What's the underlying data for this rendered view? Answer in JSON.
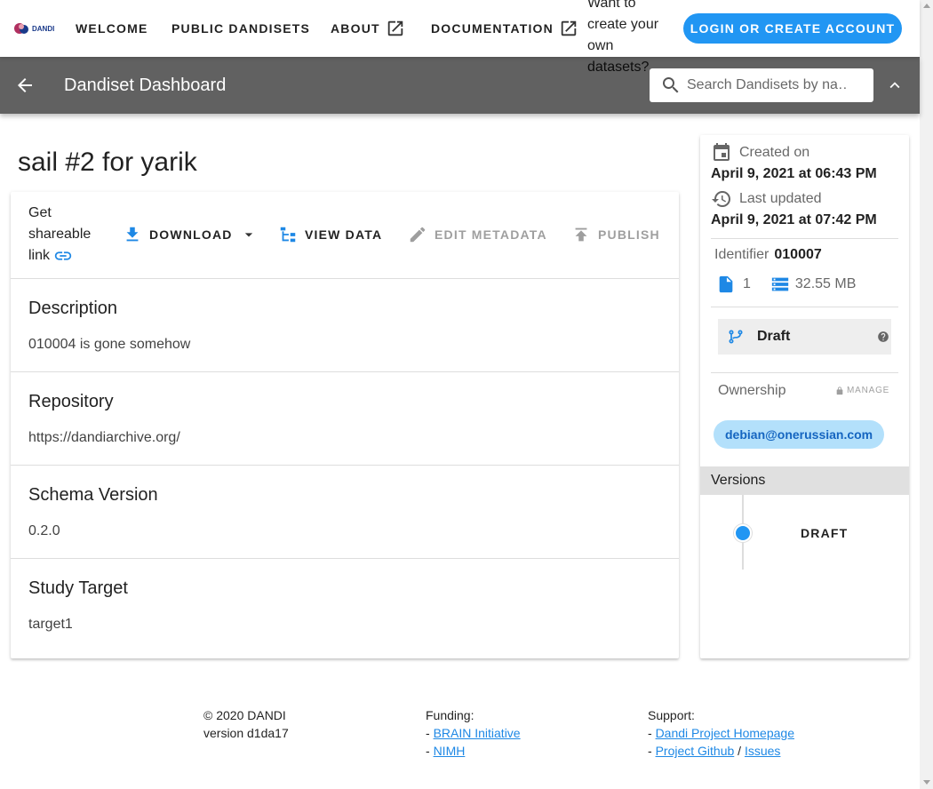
{
  "nav": {
    "logo_text": "DANDI",
    "links": [
      {
        "label": "WELCOME"
      },
      {
        "label": "PUBLIC DANDISETS"
      },
      {
        "label": "ABOUT"
      },
      {
        "label": "DOCUMENTATION"
      }
    ],
    "promo": "Want to create your own datasets?",
    "login_label": "LOGIN OR CREATE ACCOUNT"
  },
  "toolbar": {
    "title": "Dandiset Dashboard",
    "search_placeholder": "Search Dandisets by na…"
  },
  "dandiset": {
    "title": "sail #2 for yarik",
    "actions": {
      "share": "Get shareable link",
      "download": "DOWNLOAD",
      "view_data": "VIEW DATA",
      "edit_metadata": "EDIT METADATA",
      "publish": "PUBLISH"
    },
    "sections": [
      {
        "heading": "Description",
        "value": "010004 is gone somehow"
      },
      {
        "heading": "Repository",
        "value": "https://dandiarchive.org/"
      },
      {
        "heading": "Schema Version",
        "value": "0.2.0"
      },
      {
        "heading": "Study Target",
        "value": "target1"
      }
    ]
  },
  "sidebar": {
    "created_label": "Created on",
    "created_date": "April 9, 2021 at 06:43 PM",
    "updated_label": "Last updated",
    "updated_date": "April 9, 2021 at 07:42 PM",
    "identifier_label": "Identifier",
    "identifier": "010007",
    "file_count": "1",
    "size": "32.55 MB",
    "version_status": "Draft",
    "ownership_label": "Ownership",
    "manage_label": "MANAGE",
    "owner": "debian@onerussian.com",
    "versions_label": "Versions",
    "version_item": "DRAFT"
  },
  "footer": {
    "copyright": "© 2020 DANDI",
    "version": "version d1da17",
    "funding_label": "Funding:",
    "funding_links": [
      "BRAIN Initiative",
      "NIMH"
    ],
    "support_label": "Support:",
    "support_links": [
      "Dandi Project Homepage",
      "Project Github",
      "Issues"
    ]
  },
  "colors": {
    "primary": "#2196f3",
    "toolbar_bg": "#616161",
    "chip_bg": "#b3e0fb"
  }
}
